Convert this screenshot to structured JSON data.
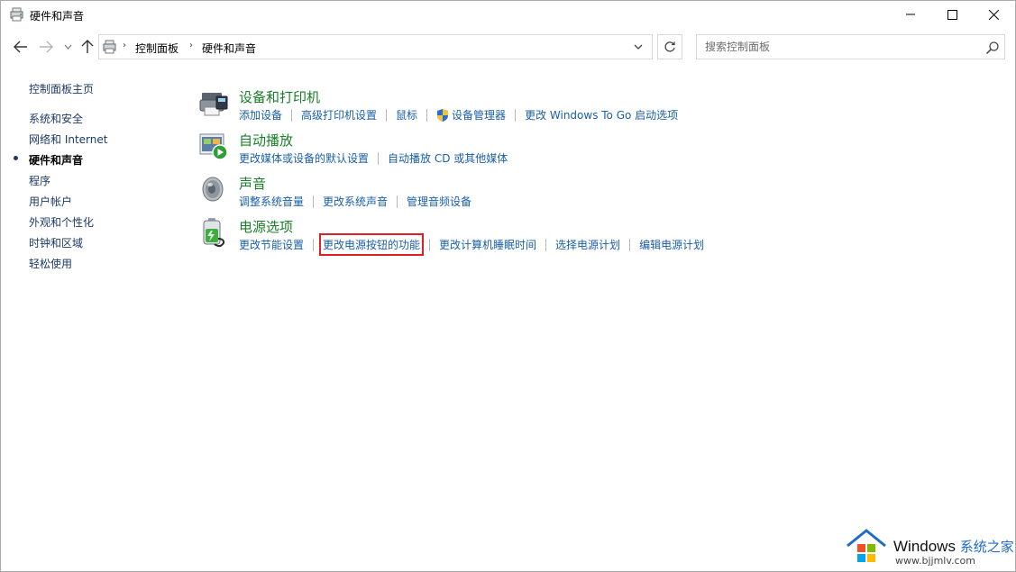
{
  "window": {
    "title": "硬件和声音"
  },
  "address_bar": {
    "crumbs": [
      "控制面板",
      "硬件和声音"
    ]
  },
  "search": {
    "placeholder": "搜索控制面板"
  },
  "left_nav": {
    "items": [
      {
        "label": "控制面板主页",
        "selected": false
      },
      {
        "label": "系统和安全",
        "selected": false
      },
      {
        "label": "网络和 Internet",
        "selected": false
      },
      {
        "label": "硬件和声音",
        "selected": true
      },
      {
        "label": "程序",
        "selected": false
      },
      {
        "label": "用户帐户",
        "selected": false
      },
      {
        "label": "外观和个性化",
        "selected": false
      },
      {
        "label": "时钟和区域",
        "selected": false
      },
      {
        "label": "轻松使用",
        "selected": false
      }
    ]
  },
  "categories": [
    {
      "title": "设备和打印机",
      "icon": "printer-icon",
      "links": [
        "添加设备",
        "高级打印机设置",
        "鼠标",
        "设备管理器",
        "更改 Windows To Go 启动选项"
      ]
    },
    {
      "title": "自动播放",
      "icon": "autoplay-icon",
      "links": [
        "更改媒体或设备的默认设置",
        "自动播放 CD 或其他媒体"
      ]
    },
    {
      "title": "声音",
      "icon": "speaker-icon",
      "links": [
        "调整系统音量",
        "更改系统声音",
        "管理音频设备"
      ]
    },
    {
      "title": "电源选项",
      "icon": "battery-icon",
      "links": [
        "更改节能设置",
        "更改电源按钮的功能",
        "更改计算机睡眠时间",
        "选择电源计划",
        "编辑电源计划"
      ],
      "highlighted_link": "更改电源按钮的功能"
    }
  ],
  "watermark": {
    "brand": "Windows",
    "brand_cn": "系统之家",
    "url": "www.bjjmlv.com"
  },
  "colors": {
    "category_title": "#1a7e29",
    "link": "#1a5fa8",
    "highlight_border": "#e02020"
  }
}
